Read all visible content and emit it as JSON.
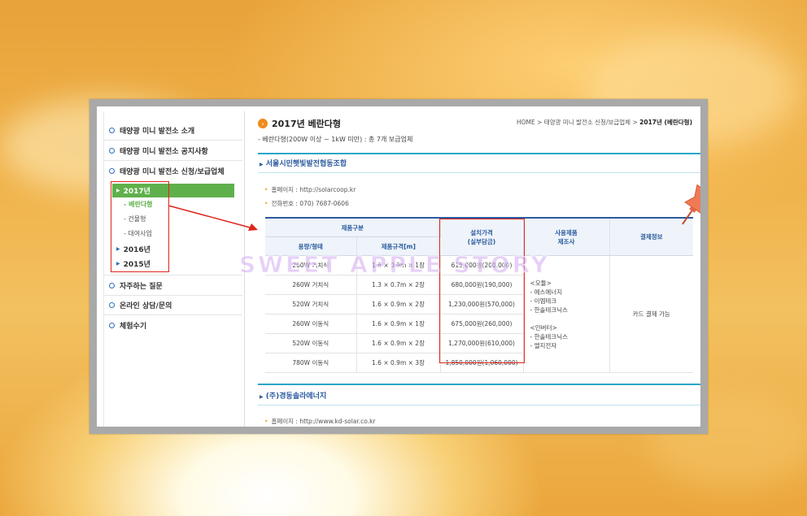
{
  "sidebar": {
    "menu": [
      {
        "label": "태양광 미니 발전소 소개"
      },
      {
        "label": "태양광 미니 발전소 공지사항"
      },
      {
        "label": "태양광 미니 발전소 신청/보급업체"
      }
    ],
    "years": {
      "active": "2017년",
      "subs": [
        "- 베란다형",
        "- 건물형",
        "- 대여사업"
      ],
      "others": [
        "2016년",
        "2015년"
      ]
    },
    "menu_bottom": [
      {
        "label": "자주하는 질문"
      },
      {
        "label": "온라인 상담/문의"
      },
      {
        "label": "체험수기"
      }
    ]
  },
  "page": {
    "title": "2017년 베란다형",
    "breadcrumb": {
      "home": "HOME",
      "sep": ">",
      "level1": "태양광 미니 발전소 신청/보급업체",
      "current": "2017년 (베란다형)"
    },
    "description": "- 베란다형(200W 이상 ~ 1kW 미만) : 총 7개 보급업체"
  },
  "company1": {
    "name": "서울시민햇빛발전협동조합",
    "homepage": "홈페이지 : http://solarcoop.kr",
    "phone": "전화번호 : 070) 7687-0606"
  },
  "table": {
    "group_header": "제품구분",
    "headers": {
      "capacity": "용량/형태",
      "spec": "제품규격[m]",
      "price_line1": "설치가격",
      "price_line2": "(실부담금)",
      "maker_line1": "사용제품",
      "maker_line2": "제조사",
      "payment": "결제정보"
    },
    "rows": [
      {
        "capacity": "260W 거치식",
        "spec": "1.6 × 0.9m × 1장",
        "price": "615,000원(200,000)"
      },
      {
        "capacity": "260W 거치식",
        "spec": "1.3 × 0.7m × 2장",
        "price": "680,000원(190,000)"
      },
      {
        "capacity": "520W 거치식",
        "spec": "1.6 × 0.9m × 2장",
        "price": "1,230,000원(570,000)"
      },
      {
        "capacity": "260W 이동식",
        "spec": "1.6 × 0.9m × 1장",
        "price": "675,000원(260,000)"
      },
      {
        "capacity": "520W 이동식",
        "spec": "1.6 × 0.9m × 2장",
        "price": "1,270,000원(610,000)"
      },
      {
        "capacity": "780W 이동식",
        "spec": "1.6 × 0.9m × 3장",
        "price": "1,850,000원(1,060,000)"
      }
    ],
    "makers": [
      "<모듈>",
      "- 에스에너지",
      "- 이엠테크",
      "- 한솔테크닉스",
      "",
      "<인버터>",
      "- 한솔테크닉스",
      "- 엘지전자"
    ],
    "payment": "카드 결제 가능"
  },
  "company2": {
    "name": "(주)경동솔라에너지",
    "homepage": "홈페이지 : http://www.kd-solar.co.kr"
  },
  "watermark": "SWEET APPLE STORY",
  "colors": {
    "accent_green": "#5fb04b",
    "accent_blue": "#2b5a9e",
    "highlight_red": "#e0241b",
    "pin": "#f07a55"
  }
}
